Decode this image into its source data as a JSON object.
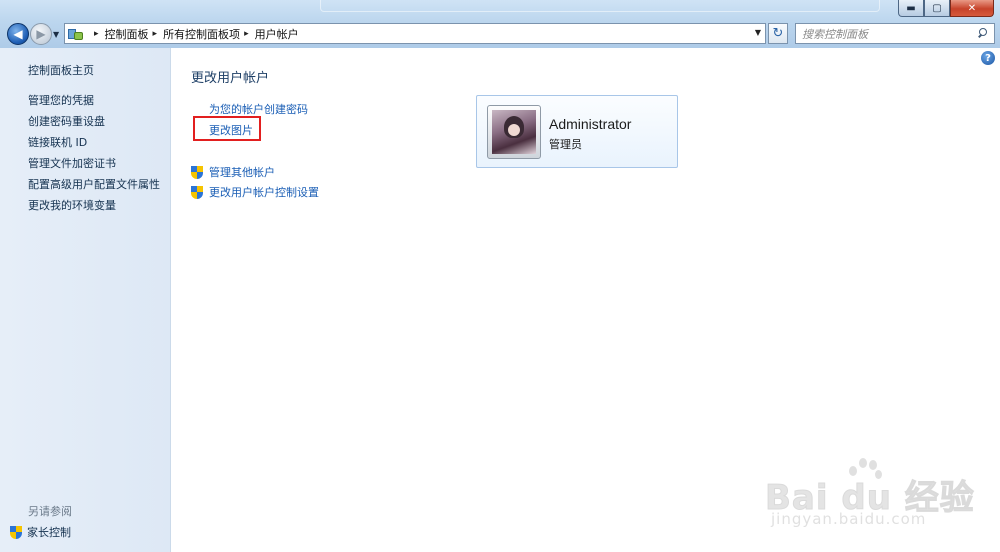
{
  "window": {
    "min_label": "▬",
    "max_label": "▢",
    "close_label": "✕"
  },
  "nav": {
    "back_label": "◀",
    "forward_label": "▶",
    "dropdown_label": "▼"
  },
  "address": {
    "crumbs": [
      "控制面板",
      "所有控制面板项",
      "用户帐户"
    ],
    "separator": "▸",
    "dropdown_label": "▼"
  },
  "refresh_label": "↻",
  "search": {
    "placeholder": "搜索控制面板"
  },
  "sidebar": {
    "home": "控制面板主页",
    "items": [
      {
        "label": "管理您的凭据"
      },
      {
        "label": "创建密码重设盘"
      },
      {
        "label": "链接联机 ID"
      },
      {
        "label": "管理文件加密证书"
      },
      {
        "label": "配置高级用户配置文件属性"
      },
      {
        "label": "更改我的环境变量"
      }
    ],
    "see_also": "另请参阅",
    "parental_controls": "家长控制"
  },
  "main": {
    "title": "更改用户帐户",
    "links": [
      {
        "label": "为您的帐户创建密码"
      },
      {
        "label": "更改图片"
      }
    ],
    "shield_links": [
      {
        "label": "管理其他帐户"
      },
      {
        "label": "更改用户帐户控制设置"
      }
    ],
    "help_label": "?"
  },
  "account": {
    "name": "Administrator",
    "role": "管理员"
  },
  "watermark": {
    "text": "Bai du 经验",
    "url": "jingyan.baidu.com"
  },
  "colors": {
    "link": "#1a5eb5",
    "highlight": "#e21f1f",
    "sidebar_bg": "#e6eef8",
    "chrome": "#bcd6ee"
  }
}
